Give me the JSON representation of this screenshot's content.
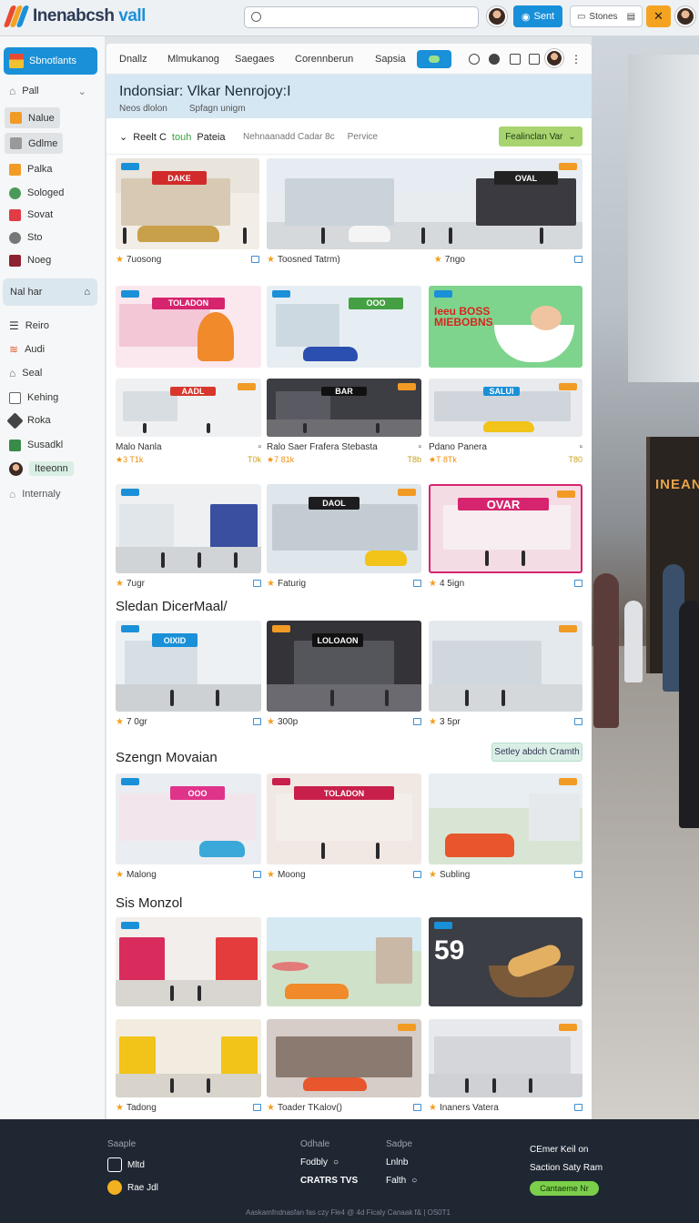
{
  "app": {
    "brand": "Inenabcsh",
    "brand_accent": "vall",
    "search_placeholder": "",
    "send_label": "Sent",
    "stones_label": "Stones",
    "alert_icon": "sparkle-icon"
  },
  "sidebar": {
    "primary": "Sbnotlants",
    "items": [
      {
        "label": "Pall",
        "icon": "home-icon",
        "color": "#777777"
      },
      {
        "label": "Nalue",
        "icon": "bolt-icon",
        "color": "#f29b24"
      },
      {
        "label": "Gdlme",
        "icon": "box-icon",
        "color": "#999999"
      },
      {
        "label": "Palka",
        "icon": "tag-icon",
        "color": "#f29b24"
      },
      {
        "label": "Sologed",
        "icon": "globe-icon",
        "color": "#4c9a5a"
      },
      {
        "label": "Sovat",
        "icon": "bookmark-icon",
        "color": "#e23b45"
      },
      {
        "label": "Sto",
        "icon": "disc-icon",
        "color": "#777777"
      },
      {
        "label": "Noeg",
        "icon": "square-icon",
        "color": "#8e2030"
      }
    ],
    "group_label": "Nal har",
    "items2": [
      {
        "label": "Reiro",
        "icon": "list-icon",
        "color": "#555555"
      },
      {
        "label": "Audi",
        "icon": "wave-icon",
        "color": "#e05a30"
      },
      {
        "label": "Seal",
        "icon": "home-icon",
        "color": "#666666"
      },
      {
        "label": "Kehing",
        "icon": "grid-icon",
        "color": "#666666"
      },
      {
        "label": "Roka",
        "icon": "tag-icon",
        "color": "#444444"
      },
      {
        "label": "Susadkl",
        "icon": "layers-icon",
        "color": "#3a8a4a"
      },
      {
        "label": "Iteeonn",
        "icon": "avatar-icon",
        "color": "#3b2a22"
      },
      {
        "label": "Internaly",
        "icon": "home-icon",
        "color": "#999999"
      }
    ]
  },
  "tabs": [
    "Dnallz",
    "Mlmukanog",
    "Saegaes",
    "Corennberun",
    "Sapsia"
  ],
  "hero": {
    "title": "Indonsiar: Vlkar Nenrojoy:I",
    "sub1": "Neos dlolon",
    "sub2": "Spfagn unigm"
  },
  "filter": {
    "left_a": "Reelt C",
    "left_b": "touh",
    "left_c": "Pateia",
    "mid_a": "Nehnaanadd Cadar 8c",
    "mid_b": "Pervice",
    "button": "Fealinclan Var"
  },
  "sections": {
    "s1": "Sledan DicerMaal/",
    "s2": "Szengn Movaian",
    "s2_button": "Setley abdch Cramth",
    "s3": "Sis Monzol"
  },
  "cards": {
    "c1": "7uosong",
    "c2": "Toosned Tatrm)",
    "c3": "7ngo",
    "c4": "Malo Nanla",
    "c4_price": "3 T1k",
    "c4_meta": "T0k",
    "c5": "Ralo Saer Frafera Stebasta",
    "c5_price": "7 81k",
    "c5_meta": "T8b",
    "c6": "Pdano Panera",
    "c6_price": "T 8Tk",
    "c6_meta": "T80",
    "c7": "7ugr",
    "c8": "Faturig",
    "c9": "4 5ign",
    "c10": "7 0gr",
    "c11": "300p",
    "c12": "3 5pr",
    "c13": "Malong",
    "c14": "Moong",
    "c15": "Subling",
    "c16": "Tadong",
    "c17": "Toader TKalov()",
    "c18": "Inaners Vatera",
    "promo_big": "59",
    "promo_food": "Ieeu BOSS MIEBOBNS",
    "store_signs": [
      "DAKE",
      "OVAL",
      "TOLADON",
      "OOO",
      "AADL",
      "BAR",
      "SALUI",
      "DAOL",
      "OVAR",
      "OIXID",
      "LOLOAON"
    ]
  },
  "footer": {
    "col1_head": "Saaple",
    "col1_a": "Mltd",
    "col1_b": "Rae Jdl",
    "col2_head": "Odhale",
    "col2_a": "Fodbly",
    "col2_b": "CRATRS TVS",
    "col3_head": "Sadpe",
    "col3_a": "Lnlnb",
    "col3_b": "Falth",
    "col4_a": "CEmer Keil on",
    "col4_b": "Saction Saty Ram",
    "col4_btn": "Cantaeme Nr",
    "copyright": "Aaskamfndnasfan fas czy Fle4 @ 4d Ficaly Canaak f& | OS0T1"
  },
  "background_sign": "INEANO"
}
